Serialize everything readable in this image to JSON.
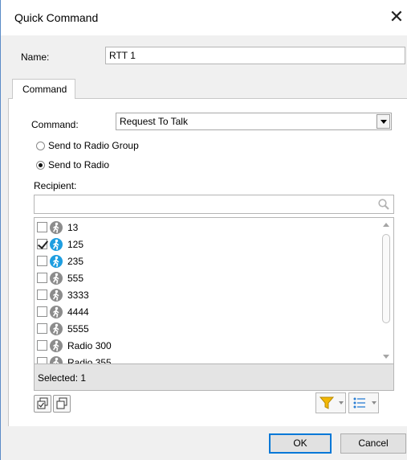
{
  "window": {
    "title": "Quick Command",
    "close_label": "✕"
  },
  "name": {
    "label": "Name:",
    "value": "RTT 1"
  },
  "tab": {
    "label": "Command"
  },
  "command": {
    "label": "Command:",
    "selected": "Request To Talk"
  },
  "target": {
    "options": [
      {
        "label": "Send to Radio Group",
        "checked": false
      },
      {
        "label": "Send to Radio",
        "checked": true
      }
    ]
  },
  "recipient": {
    "label": "Recipient:",
    "search_placeholder": "",
    "items": [
      {
        "label": "13",
        "checked": false,
        "status": "offline"
      },
      {
        "label": "125",
        "checked": true,
        "status": "online"
      },
      {
        "label": "235",
        "checked": false,
        "status": "online"
      },
      {
        "label": "555",
        "checked": false,
        "status": "offline"
      },
      {
        "label": "3333",
        "checked": false,
        "status": "offline"
      },
      {
        "label": "4444",
        "checked": false,
        "status": "offline"
      },
      {
        "label": "5555",
        "checked": false,
        "status": "offline"
      },
      {
        "label": "Radio 300",
        "checked": false,
        "status": "offline"
      },
      {
        "label": "Radio 355",
        "checked": false,
        "status": "offline"
      }
    ],
    "selected_text": "Selected: 1"
  },
  "colors": {
    "online": "#1e9ee0",
    "offline": "#8c8c8c",
    "filter": "#f2b705",
    "list_icon": "#2a7fd4"
  },
  "buttons": {
    "ok": "OK",
    "cancel": "Cancel"
  }
}
